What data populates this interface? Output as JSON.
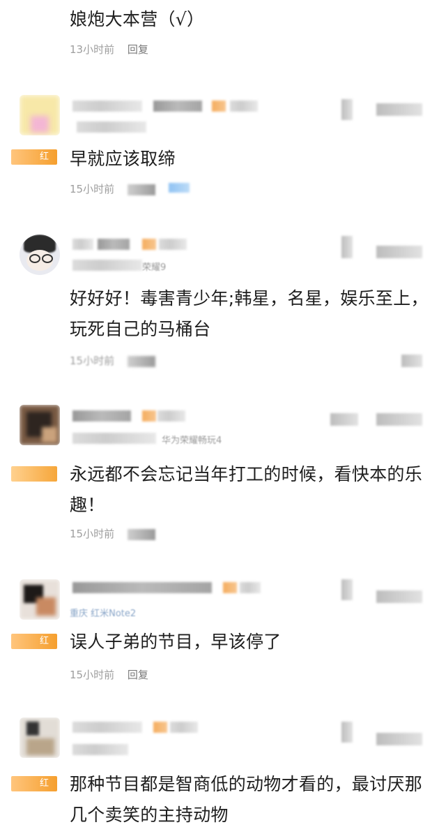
{
  "comments": [
    {
      "text": "娘炮大本营（√）",
      "time": "13小时前",
      "reply": "回复"
    },
    {
      "badge": "红",
      "text": "早就应该取缔",
      "time": "15小时前"
    },
    {
      "text": "好好好！毒害青少年;韩星，名星，娱乐至上，玩死自己的马桶台",
      "time": "15小时前",
      "device": "荣耀9"
    },
    {
      "text": "永远都不会忘记当年打工的时候，看快本的乐趣！",
      "time": "15小时前",
      "device": "华为荣耀畅玩4"
    },
    {
      "badge": "红",
      "text": "误人子弟的节目，早该停了",
      "time": "15小时前",
      "reply": "回复",
      "device": "重庆 红米Note2"
    },
    {
      "badge": "红",
      "text": "那种节目都是智商低的动物才看的，最讨厌那几个卖笑的主持动物"
    }
  ]
}
